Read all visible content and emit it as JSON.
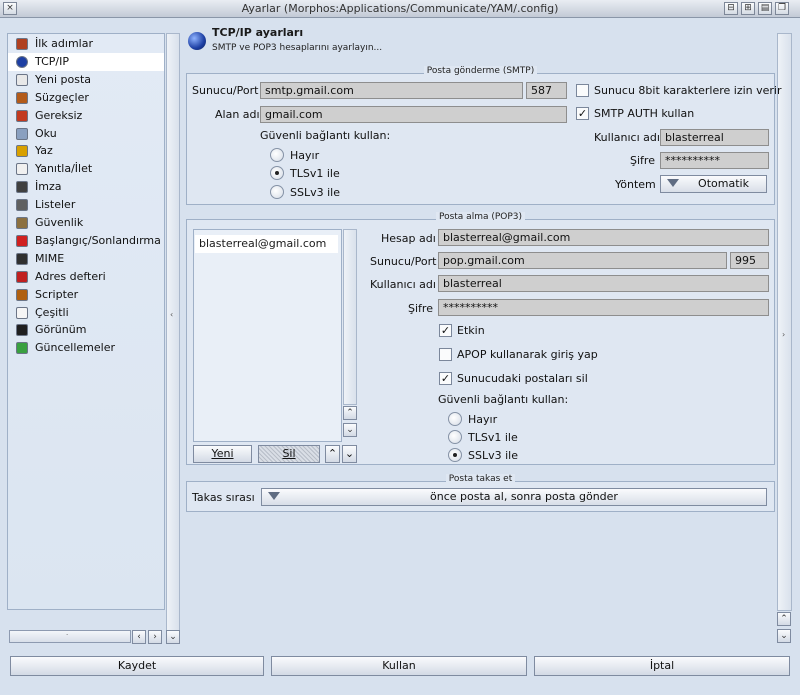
{
  "window": {
    "title": "Ayarlar (Morphos:Applications/Communicate/YAM/.config)",
    "close_glyph": "×"
  },
  "sidebar": {
    "items": [
      {
        "label": "İlk adımlar",
        "icon": "first-steps-icon",
        "color": "#b04020"
      },
      {
        "label": "TCP/IP",
        "icon": "globe-icon",
        "color": "#1d3fa3"
      },
      {
        "label": "Yeni posta",
        "icon": "new-mail-icon",
        "color": "#e8e8e8"
      },
      {
        "label": "Süzgeçler",
        "icon": "filter-icon",
        "color": "#b35b1a"
      },
      {
        "label": "Gereksiz",
        "icon": "spam-icon",
        "color": "#c23a20"
      },
      {
        "label": "Oku",
        "icon": "magnifier-icon",
        "color": "#8aa0c0"
      },
      {
        "label": "Yaz",
        "icon": "pencil-icon",
        "color": "#d8a000"
      },
      {
        "label": "Yanıtla/İlet",
        "icon": "reply-icon",
        "color": "#f0f0f0"
      },
      {
        "label": "İmza",
        "icon": "signature-icon",
        "color": "#404040"
      },
      {
        "label": "Listeler",
        "icon": "lists-icon",
        "color": "#606060"
      },
      {
        "label": "Güvenlik",
        "icon": "security-icon",
        "color": "#8c7040"
      },
      {
        "label": "Başlangıç/Sonlandırma",
        "icon": "startup-icon",
        "color": "#d02020"
      },
      {
        "label": "MIME",
        "icon": "mime-icon",
        "color": "#303030"
      },
      {
        "label": "Adres defteri",
        "icon": "addressbook-icon",
        "color": "#c02020"
      },
      {
        "label": "Scripter",
        "icon": "scripts-icon",
        "color": "#b06010"
      },
      {
        "label": "Çeşitli",
        "icon": "misc-icon",
        "color": "#f5f5f5"
      },
      {
        "label": "Görünüm",
        "icon": "display-icon",
        "color": "#202020"
      },
      {
        "label": "Güncellemeler",
        "icon": "updates-icon",
        "color": "#3aa040"
      }
    ],
    "selected_index": 1
  },
  "header": {
    "title": "TCP/IP ayarları",
    "subtitle": "SMTP ve POP3 hesaplarını ayarlayın..."
  },
  "smtp": {
    "group_label": "Posta gönderme (SMTP)",
    "server_label": "Sunucu/Port",
    "server": "smtp.gmail.com",
    "port": "587",
    "domain_label": "Alan adı",
    "domain": "gmail.com",
    "secure_label": "Güvenli bağlantı kullan:",
    "secure_options": [
      "Hayır",
      "TLSv1 ile",
      "SSLv3 ile"
    ],
    "secure_selected": 1,
    "allow8bit_label": "Sunucu 8bit karakterlere izin verir",
    "allow8bit": false,
    "auth_label": "SMTP AUTH  kullan",
    "auth": true,
    "user_label": "Kullanıcı adı",
    "user": "blasterreal",
    "password_label": "Şifre",
    "password": "**********",
    "method_label": "Yöntem",
    "method": "Otomatik"
  },
  "pop3": {
    "group_label": "Posta alma (POP3)",
    "accounts": [
      "blasterreal@gmail.com"
    ],
    "new_button": "Yeni",
    "delete_button": "Sil",
    "account_label": "Hesap adı",
    "account": "blasterreal@gmail.com",
    "server_label": "Sunucu/Port",
    "server": "pop.gmail.com",
    "port": "995",
    "user_label": "Kullanıcı adı",
    "user": "blasterreal",
    "password_label": "Şifre",
    "password": "**********",
    "enabled_label": "Etkin",
    "enabled": true,
    "apop_label": "APOP kullanarak giriş yap",
    "apop": false,
    "delete_on_server_label": "Sunucudaki postaları sil",
    "delete_on_server": true,
    "secure_label": "Güvenli bağlantı kullan:",
    "secure_options": [
      "Hayır",
      "TLSv1 ile",
      "SSLv3 ile"
    ],
    "secure_selected": 2
  },
  "exchange": {
    "group_label": "Posta takas et",
    "order_label": "Takas sırası",
    "order": "önce posta al, sonra posta gönder"
  },
  "footer": {
    "save": "Kaydet",
    "use": "Kullan",
    "cancel": "İptal"
  }
}
